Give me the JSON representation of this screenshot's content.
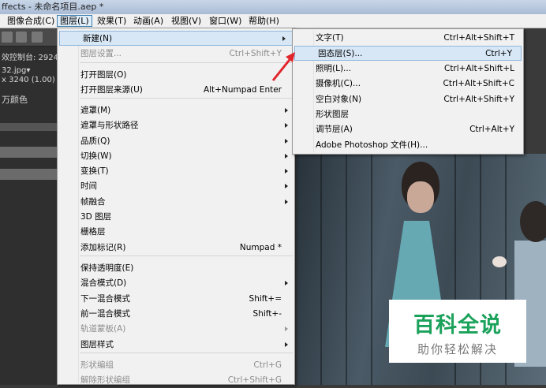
{
  "window": {
    "title": "ffects - 未命名项目.aep *"
  },
  "menubar": [
    {
      "label": "图像合成(C)"
    },
    {
      "label": "图层(L)"
    },
    {
      "label": "效果(T)"
    },
    {
      "label": "动画(A)"
    },
    {
      "label": "视图(V)"
    },
    {
      "label": "窗口(W)"
    },
    {
      "label": "帮助(H)"
    }
  ],
  "left_panel": {
    "control_label": "效控制台: 2924",
    "file_name": "32.jpg▾",
    "resolution": "x 3240 (1.00)",
    "colors": "万颜色"
  },
  "layer_menu": [
    {
      "label": "新建(N)",
      "shortcut": "",
      "submenu": true,
      "disabled": false,
      "highlight": true
    },
    {
      "label": "图层设置...",
      "shortcut": "Ctrl+Shift+Y",
      "submenu": false,
      "disabled": true
    },
    {
      "label": "打开图层(O)",
      "shortcut": "",
      "submenu": false,
      "disabled": false
    },
    {
      "label": "打开图层来源(U)",
      "shortcut": "Alt+Numpad Enter",
      "submenu": false,
      "disabled": false
    },
    {
      "label": "遮罩(M)",
      "shortcut": "",
      "submenu": true,
      "disabled": false
    },
    {
      "label": "遮罩与形状路径",
      "shortcut": "",
      "submenu": true,
      "disabled": false
    },
    {
      "label": "品质(Q)",
      "shortcut": "",
      "submenu": true,
      "disabled": false
    },
    {
      "label": "切换(W)",
      "shortcut": "",
      "submenu": true,
      "disabled": false
    },
    {
      "label": "变换(T)",
      "shortcut": "",
      "submenu": true,
      "disabled": false
    },
    {
      "label": "时间",
      "shortcut": "",
      "submenu": true,
      "disabled": false
    },
    {
      "label": "帧融合",
      "shortcut": "",
      "submenu": true,
      "disabled": false
    },
    {
      "label": "3D 图层",
      "shortcut": "",
      "submenu": false,
      "disabled": false
    },
    {
      "label": "栅格层",
      "shortcut": "",
      "submenu": false,
      "disabled": false
    },
    {
      "label": "添加标记(R)",
      "shortcut": "Numpad *",
      "submenu": false,
      "disabled": false
    },
    {
      "label": "保持透明度(E)",
      "shortcut": "",
      "submenu": false,
      "disabled": false
    },
    {
      "label": "混合模式(D)",
      "shortcut": "",
      "submenu": true,
      "disabled": false
    },
    {
      "label": "下一混合模式",
      "shortcut": "Shift+=",
      "submenu": false,
      "disabled": false
    },
    {
      "label": "前一混合模式",
      "shortcut": "Shift+-",
      "submenu": false,
      "disabled": false
    },
    {
      "label": "轨道蒙板(A)",
      "shortcut": "",
      "submenu": true,
      "disabled": true
    },
    {
      "label": "图层样式",
      "shortcut": "",
      "submenu": true,
      "disabled": false
    },
    {
      "label": "形状编组",
      "shortcut": "Ctrl+G",
      "submenu": false,
      "disabled": true
    },
    {
      "label": "解除形状编组",
      "shortcut": "Ctrl+Shift+G",
      "submenu": false,
      "disabled": true
    }
  ],
  "new_submenu": [
    {
      "label": "文字(T)",
      "shortcut": "Ctrl+Alt+Shift+T"
    },
    {
      "label": "固态层(S)...",
      "shortcut": "Ctrl+Y",
      "highlight": true
    },
    {
      "label": "照明(L)...",
      "shortcut": "Ctrl+Alt+Shift+L"
    },
    {
      "label": "摄像机(C)...",
      "shortcut": "Ctrl+Alt+Shift+C"
    },
    {
      "label": "空白对象(N)",
      "shortcut": "Ctrl+Alt+Shift+Y"
    },
    {
      "label": "形状图层",
      "shortcut": ""
    },
    {
      "label": "调节层(A)",
      "shortcut": "Ctrl+Alt+Y"
    },
    {
      "label": "Adobe Photoshop 文件(H)...",
      "shortcut": ""
    }
  ],
  "watermark": {
    "main": "百科全说",
    "sub": "助你轻松解决"
  },
  "colors": {
    "menu_bg": "#f1f1f1",
    "highlight": "#d7e7f6",
    "arrow": "#e0252b",
    "watermark_green": "#1aa15a"
  }
}
